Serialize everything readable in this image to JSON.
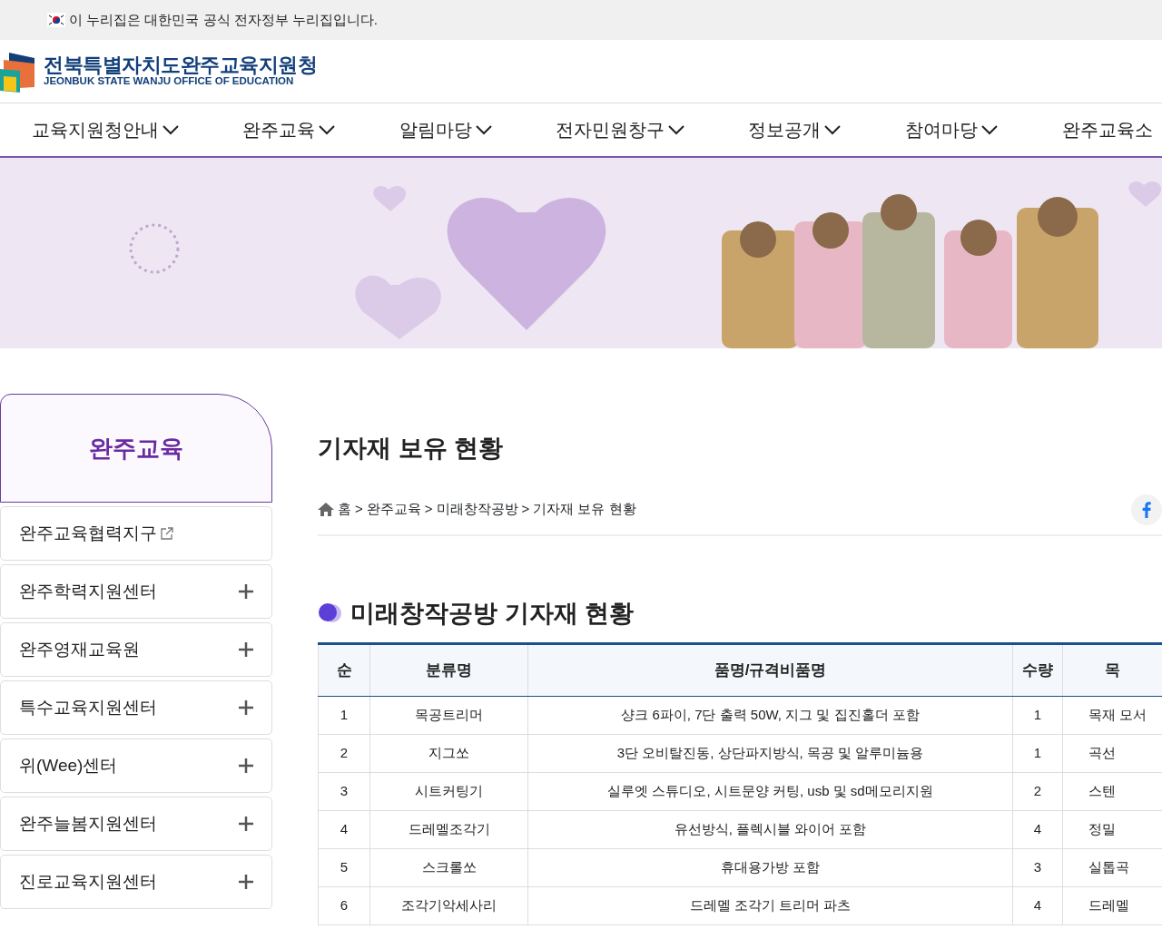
{
  "gov_notice": {
    "text": "이 누리집은 대한민국 공식 전자정부 누리집입니다."
  },
  "logo": {
    "name": "전북특별자치도완주교육지원청",
    "subtitle": "JEONBUK STATE WANJU OFFICE OF EDUCATION"
  },
  "nav": [
    {
      "label": "교육지원청안내"
    },
    {
      "label": "완주교육"
    },
    {
      "label": "알림마당"
    },
    {
      "label": "전자민원창구"
    },
    {
      "label": "정보공개"
    },
    {
      "label": "참여마당"
    },
    {
      "label": "완주교육소"
    }
  ],
  "sidebar": {
    "title": "완주교육",
    "items": [
      {
        "label": "완주교육협력지구",
        "kind": "external"
      },
      {
        "label": "완주학력지원센터",
        "kind": "expand"
      },
      {
        "label": "완주영재교육원",
        "kind": "expand"
      },
      {
        "label": "특수교육지원센터",
        "kind": "expand"
      },
      {
        "label": "위(Wee)센터",
        "kind": "expand"
      },
      {
        "label": "완주늘봄지원센터",
        "kind": "expand"
      },
      {
        "label": "진로교육지원센터",
        "kind": "expand"
      }
    ]
  },
  "page_title": "기자재 보유 현황",
  "breadcrumb": [
    "홈",
    ">",
    "완주교육",
    ">",
    "미래창작공방",
    ">",
    "기자재 보유 현황"
  ],
  "section_title": "미래창작공방 기자재 현황",
  "table": {
    "columns": [
      "순",
      "분류명",
      "품명/규격비품명",
      "수량",
      "목"
    ],
    "rows": [
      [
        "1",
        "목공트리머",
        "샹크 6파이, 7단 출력 50W, 지그 및 집진홀더 포함",
        "1",
        "목재 모서"
      ],
      [
        "2",
        "지그쏘",
        "3단 오비탈진동, 상단파지방식, 목공 및 알루미늄용",
        "1",
        "곡선"
      ],
      [
        "3",
        "시트커팅기",
        "실루엣 스튜디오, 시트문양 커팅, usb 및 sd메모리지원",
        "2",
        "스텐"
      ],
      [
        "4",
        "드레멜조각기",
        "유선방식, 플렉시블 와이어 포함",
        "4",
        "정밀"
      ],
      [
        "5",
        "스크롤쏘",
        "휴대용가방 포함",
        "3",
        "실톱곡"
      ],
      [
        "6",
        "조각기악세사리",
        "드레멜 조각기 트리머 파츠",
        "4",
        "드레멜"
      ]
    ]
  }
}
